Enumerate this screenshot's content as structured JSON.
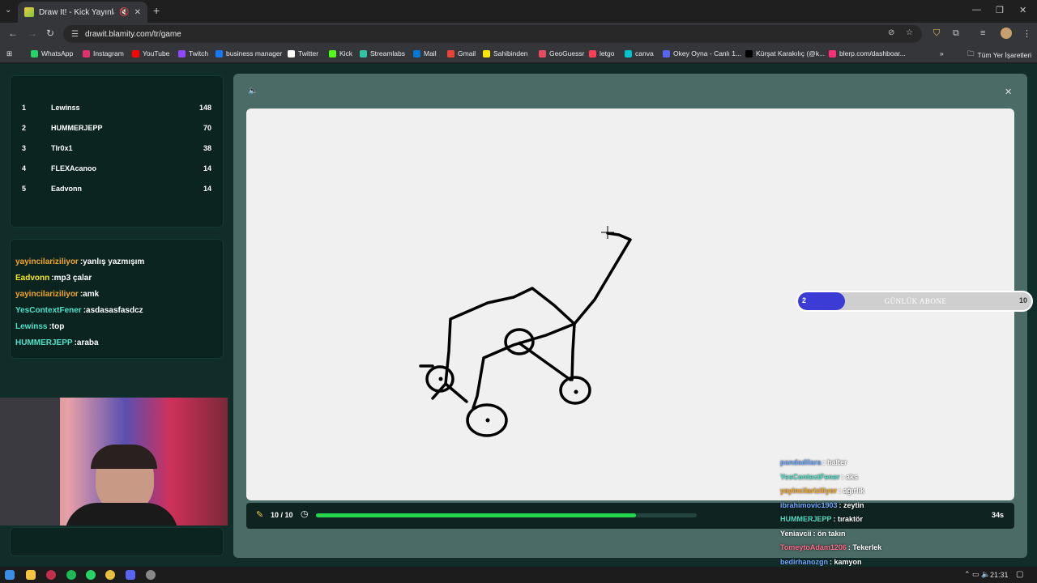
{
  "browser": {
    "tab_title": "Draw It! - Kick Yayınları İçin",
    "url": "drawit.blamity.com/tr/game",
    "bookmarks": [
      {
        "label": "WhatsApp",
        "color": "#25d366"
      },
      {
        "label": "Instagram",
        "color": "#e1306c"
      },
      {
        "label": "YouTube",
        "color": "#ff0000"
      },
      {
        "label": "Twitch",
        "color": "#9146ff"
      },
      {
        "label": "business manager",
        "color": "#1877f2"
      },
      {
        "label": "Twitter",
        "color": "#ffffff"
      },
      {
        "label": "Kick",
        "color": "#53fc18"
      },
      {
        "label": "Streamlabs",
        "color": "#31c3a2"
      },
      {
        "label": "Mail",
        "color": "#0078d4"
      },
      {
        "label": "Gmail",
        "color": "#ea4335"
      },
      {
        "label": "Sahibinden",
        "color": "#ffe800"
      },
      {
        "label": "GeoGuessr",
        "color": "#e84a5f"
      },
      {
        "label": "letgo",
        "color": "#ff3f55"
      },
      {
        "label": "canva",
        "color": "#00c4cc"
      },
      {
        "label": "Okey Oyna - Canlı 1...",
        "color": "#5865f2"
      },
      {
        "label": "Kürşat Karakılıç (@k...",
        "color": "#000000"
      },
      {
        "label": "blerp.com/dashboar...",
        "color": "#ff2d7a"
      }
    ],
    "all_bookmarks": "Tüm Yer İşaretleri"
  },
  "leaderboard": [
    {
      "rank": "1",
      "name": "Lewinss",
      "score": "148"
    },
    {
      "rank": "2",
      "name": "HUMMERJEPP",
      "score": "70"
    },
    {
      "rank": "3",
      "name": "Tlr0x1",
      "score": "38"
    },
    {
      "rank": "4",
      "name": "FLEXAcanoo",
      "score": "14"
    },
    {
      "rank": "5",
      "name": "Eadvonn",
      "score": "14"
    }
  ],
  "chat": [
    {
      "user": "yayincilariziliyor",
      "msg": ":yanlış yazmışım",
      "color": "#f5a623"
    },
    {
      "user": "Eadvonn",
      "msg": ":mp3 çalar",
      "color": "#f5e623"
    },
    {
      "user": "yayincilariziliyor",
      "msg": ":amk",
      "color": "#f5a623"
    },
    {
      "user": "YesContextFener",
      "msg": ":asdasasfasdcz",
      "color": "#4ee0c8"
    },
    {
      "user": "Lewinss",
      "msg": ":top",
      "color": "#4ee0c8"
    },
    {
      "user": "HUMMERJEPP",
      "msg": ":araba",
      "color": "#4ee0c8"
    }
  ],
  "game": {
    "round": "10 / 10",
    "timer": "34s",
    "progress": 0.84
  },
  "subscriber_goal": {
    "current": "2",
    "label": "GÜNLÜK ABONE",
    "target": "10",
    "fill": 0.2
  },
  "overlay_chat": [
    {
      "user": "pandadilara",
      "msg": " : halter",
      "color": "#6fa8ff"
    },
    {
      "user": "YesContextFener",
      "msg": " : aks",
      "color": "#4ee0c8"
    },
    {
      "user": "yayincilariziliyor",
      "msg": " : ağırlık",
      "color": "#f5a623"
    },
    {
      "user": "ibrahimovic1903",
      "msg": " : zeytin",
      "color": "#6fa8ff"
    },
    {
      "user": "HUMMERJEPP",
      "msg": " : tıraktör",
      "color": "#4ee0c8"
    },
    {
      "user": "Yeniavcii",
      "msg": " : ön takın",
      "color": "#ffffff"
    },
    {
      "user": "TomeytoAdam1206",
      "msg": " : Tekerlek",
      "color": "#ff6b8a"
    },
    {
      "user": "bedirhanozgn",
      "msg": " : kamyon",
      "color": "#6fa8ff"
    }
  ],
  "taskbar": {
    "time": "21:31"
  }
}
